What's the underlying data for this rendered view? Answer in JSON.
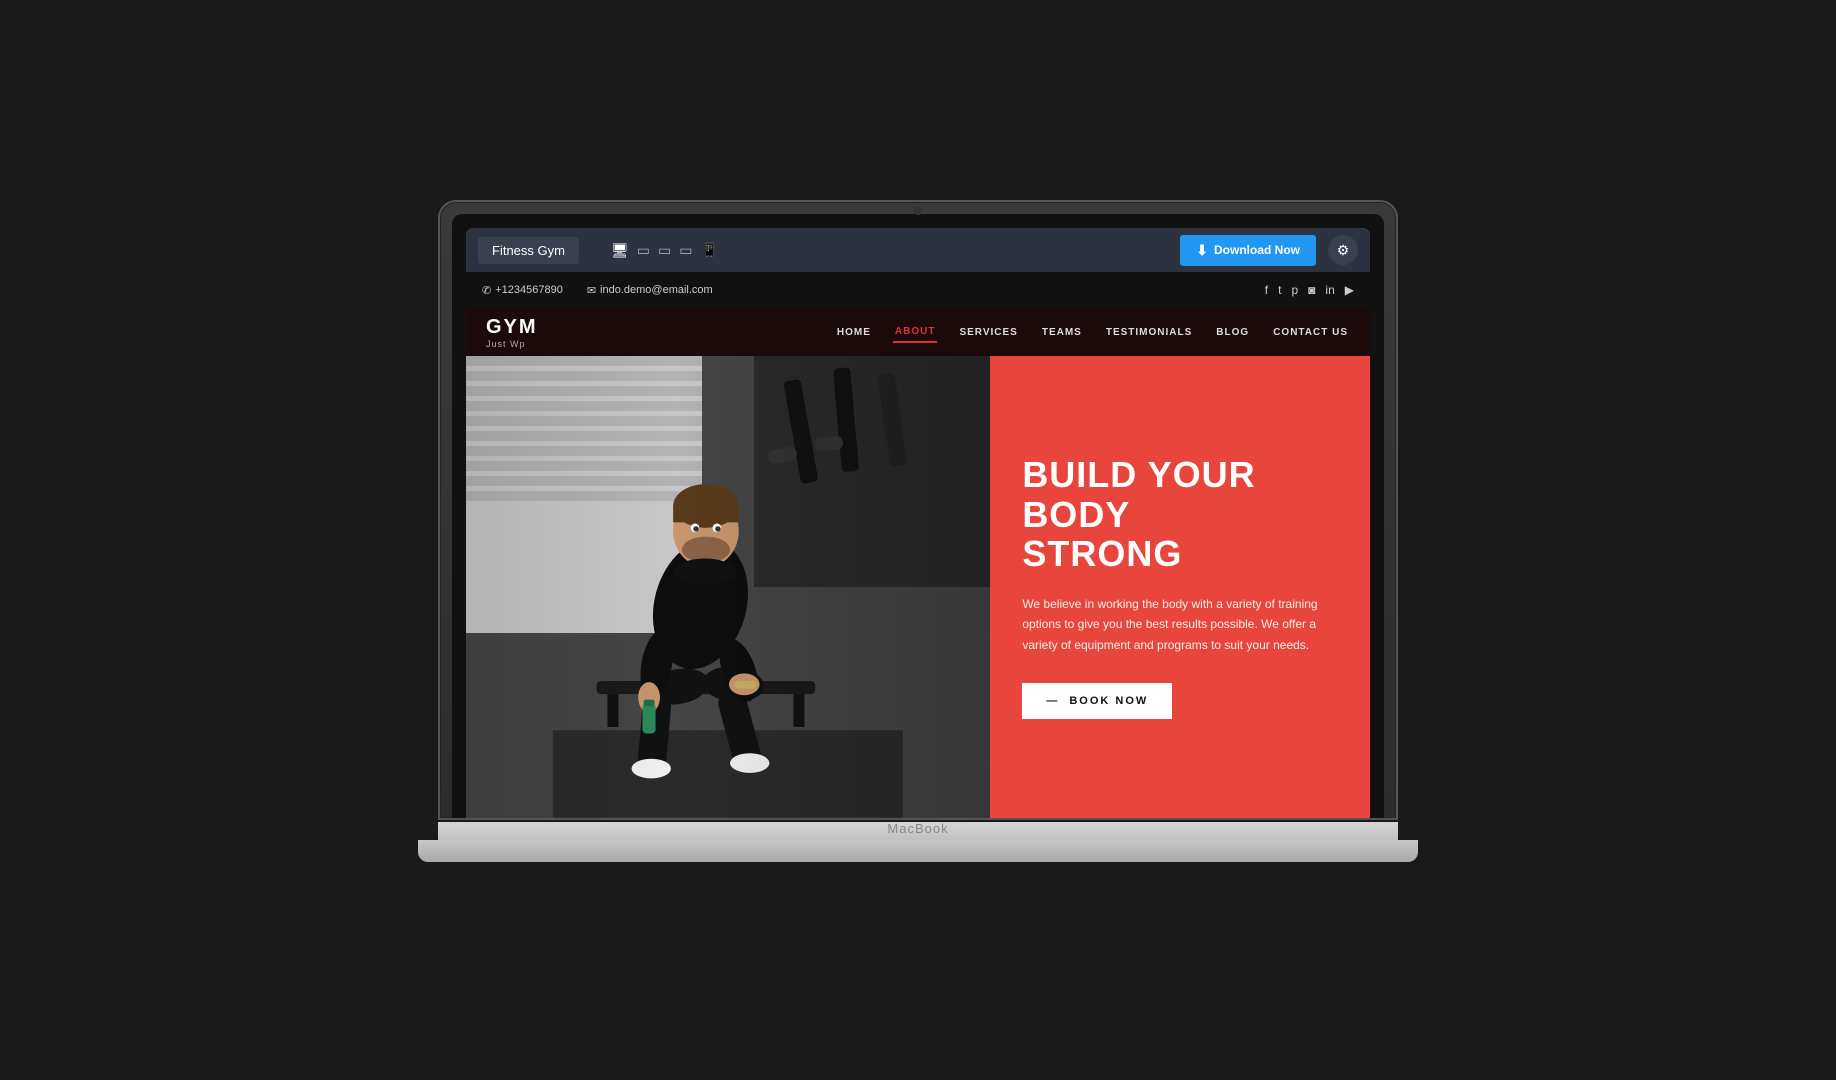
{
  "macbook": {
    "label": "MacBook"
  },
  "toolbar": {
    "title": "Fitness Gym",
    "download_label": "Download Now",
    "download_icon": "⬇",
    "gear_icon": "⚙",
    "devices": [
      {
        "icon": "🖥",
        "active": true
      },
      {
        "icon": "▭",
        "active": false
      },
      {
        "icon": "▭",
        "active": false
      },
      {
        "icon": "▭",
        "active": false
      },
      {
        "icon": "📱",
        "active": false
      }
    ]
  },
  "contact_bar": {
    "phone": "+1234567890",
    "email": "indo.demo@email.com",
    "phone_icon": "📞",
    "email_icon": "✉",
    "social": [
      "f",
      "t",
      "p",
      "📷",
      "in",
      "▶"
    ]
  },
  "navbar": {
    "logo_name": "GYM",
    "logo_sub": "Just Wp",
    "links": [
      {
        "label": "HOME",
        "active": false
      },
      {
        "label": "ABOUT",
        "active": true
      },
      {
        "label": "SERVICES",
        "active": false
      },
      {
        "label": "TEAMS",
        "active": false
      },
      {
        "label": "TESTIMONIALS",
        "active": false
      },
      {
        "label": "BLOG",
        "active": false
      },
      {
        "label": "CONTACT US",
        "active": false
      }
    ]
  },
  "hero": {
    "title_line1": "BUILD YOUR BODY",
    "title_line2": "STRONG",
    "description": "We believe in working the body with a variety of training options to give you the best results possible. We offer a variety of equipment and programs to suit your needs.",
    "cta_label": "BOOK NOW",
    "cta_arrow": "—",
    "bg_color": "#e8453c"
  }
}
